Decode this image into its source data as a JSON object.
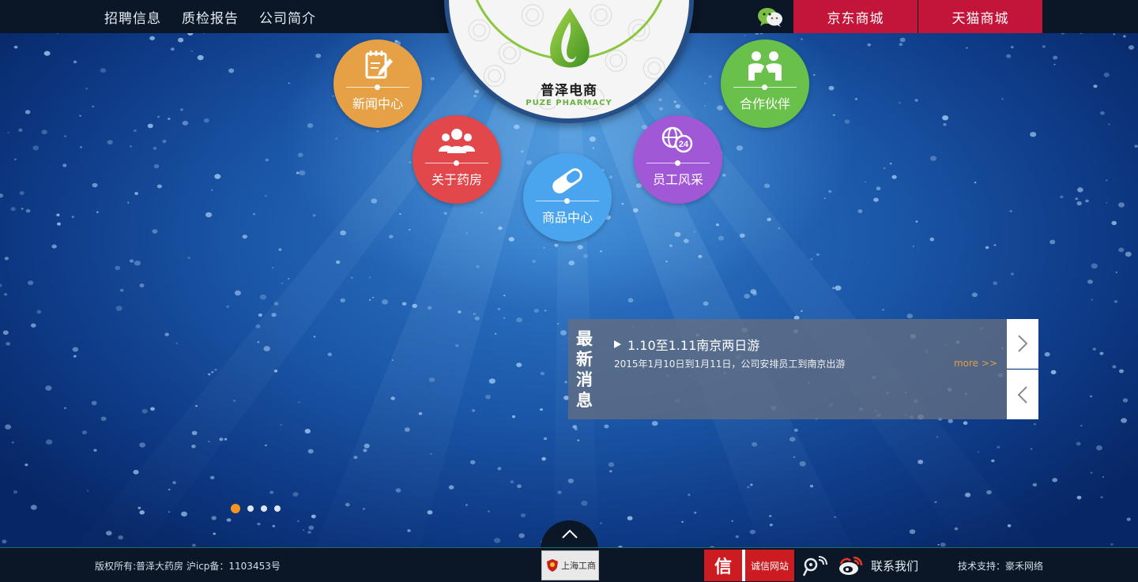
{
  "topbar": {
    "nav": [
      "招聘信息",
      "质检报告",
      "公司简介"
    ],
    "wechat_icon": "wechat-icon",
    "mall_links": [
      "京东商城",
      "天猫商城"
    ],
    "mall_color": "#c3143a"
  },
  "logo": {
    "name": "普泽电商",
    "english": "PUZE PHARMACY",
    "accent": "#8cc63e"
  },
  "circle_nav": [
    {
      "label": "新闻中心",
      "icon": "notepad-pen-icon",
      "color": "#e6a046"
    },
    {
      "label": "关于药房",
      "icon": "people-group-icon",
      "color": "#e2474c"
    },
    {
      "label": "商品中心",
      "icon": "capsule-icon",
      "color": "#4aa5ee"
    },
    {
      "label": "员工风采",
      "icon": "24h-globe-icon",
      "color": "#a158d6"
    },
    {
      "label": "合作伙伴",
      "icon": "handshake-icon",
      "color": "#69c04a"
    }
  ],
  "news": {
    "title": "最新消息",
    "headline": "1.10至1.11南京两日游",
    "description": "2015年1月10日到1月11日，公司安排员工到南京出游",
    "more": "more >>",
    "next_icon": "chevron-right-icon",
    "prev_icon": "chevron-left-icon"
  },
  "slider": {
    "total": 4,
    "active": 1,
    "active_color": "#f39423"
  },
  "up_button_icon": "chevron-up-icon",
  "footer": {
    "copyright": "版权所有:普泽大药房   沪icp备：1103453号",
    "shanghai_badge": "上海工商",
    "credit_char": "信",
    "credit_label": "诚信网站",
    "contact": "联系我们",
    "tech_support": "技术支持：豪禾网络"
  }
}
